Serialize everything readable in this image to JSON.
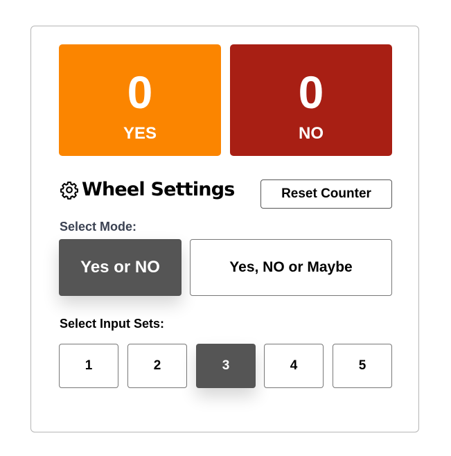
{
  "counters": {
    "yes": {
      "value": "0",
      "label": "YES",
      "color": "#fb8500"
    },
    "no": {
      "value": "0",
      "label": "NO",
      "color": "#a81f14"
    }
  },
  "settings": {
    "title": "Wheel Settings",
    "icon": "gear-icon",
    "reset_label": "Reset Counter"
  },
  "mode": {
    "label": "Select Mode:",
    "options": [
      "Yes or NO",
      "Yes, NO or Maybe"
    ],
    "selected": "Yes or NO"
  },
  "input_sets": {
    "label": "Select Input Sets:",
    "options": [
      "1",
      "2",
      "3",
      "4",
      "5"
    ],
    "selected": "3"
  },
  "colors": {
    "active_button": "#555555",
    "label_text": "#3b4252"
  }
}
